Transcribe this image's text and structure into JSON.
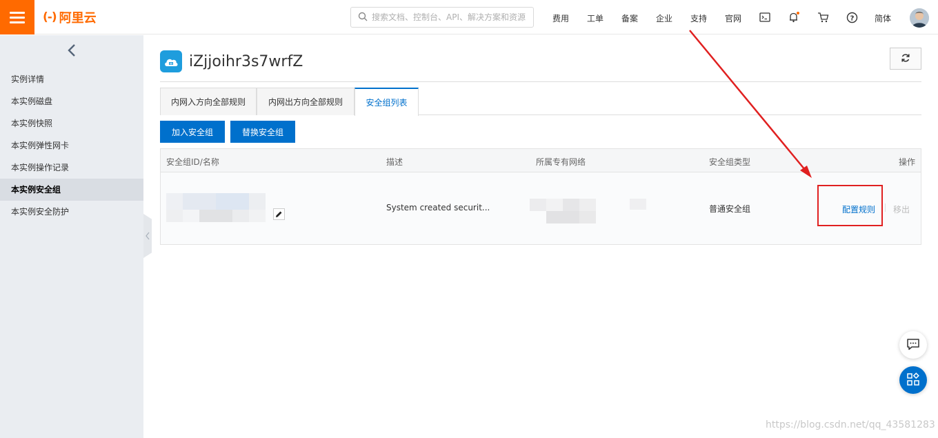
{
  "header": {
    "logo_mark": "(-)",
    "logo_text": "阿里云",
    "search_placeholder": "搜索文档、控制台、API、解决方案和资源",
    "nav": [
      "费用",
      "工单",
      "备案",
      "企业",
      "支持",
      "官网"
    ],
    "lang": "简体",
    "notification_dot_color": "#ff6a00"
  },
  "sidebar": {
    "items": [
      "实例详情",
      "本实例磁盘",
      "本实例快照",
      "本实例弹性网卡",
      "本实例操作记录",
      "本实例安全组",
      "本实例安全防护"
    ],
    "active_index": 5
  },
  "page": {
    "title": "iZjjoihr3s7wrfZ"
  },
  "tabs": [
    "内网入方向全部规则",
    "内网出方向全部规则",
    "安全组列表"
  ],
  "active_tab": 2,
  "actions": {
    "join": "加入安全组",
    "replace": "替换安全组"
  },
  "table": {
    "headers": [
      "安全组ID/名称",
      "描述",
      "所属专有网络",
      "安全组类型",
      "操作"
    ],
    "rows": [
      {
        "description": "System created securit...",
        "type": "普通安全组",
        "configure": "配置规则",
        "remove": "移出"
      }
    ]
  },
  "watermark": "https://blog.csdn.net/qq_43581283",
  "colors": {
    "brand": "#ff6a00",
    "primary": "#0070cc",
    "annotation": "#e02020"
  }
}
